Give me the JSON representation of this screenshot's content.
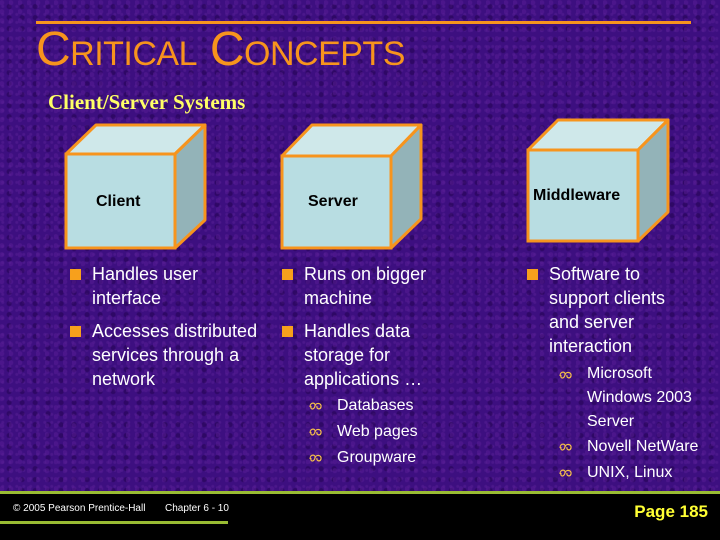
{
  "slide": {
    "title": "Critical Concepts",
    "subtitle": "Client/Server Systems"
  },
  "cubes": [
    {
      "label": "Client"
    },
    {
      "label": "Server"
    },
    {
      "label": "Middleware"
    }
  ],
  "columns": {
    "client": {
      "bullets": [
        {
          "text": "Handles user interface"
        },
        {
          "text": "Accesses distributed services through a network"
        }
      ]
    },
    "server": {
      "bullets": [
        {
          "text": "Runs on bigger machine"
        },
        {
          "text": "Handles data storage for applications …"
        }
      ],
      "sub_bullets": [
        "Databases",
        "Web pages",
        "Groupware"
      ]
    },
    "middleware": {
      "bullets": [
        {
          "text": "Software to support clients and server interaction"
        }
      ],
      "sub_bullets": [
        "Microsoft Windows 2003 Server",
        "Novell NetWare",
        "UNIX, Linux"
      ]
    }
  },
  "footer": {
    "copyright": "© 2005  Pearson Prentice-Hall",
    "chapter": "Chapter 6 - 10",
    "page": "Page 185"
  },
  "colors": {
    "background": "#3d0f80",
    "accent_orange": "#f7941d",
    "subtitle_yellow": "#ffff66",
    "cube_face": "#b8dde2",
    "footer_green": "#99bb33",
    "page_yellow": "#ffff33"
  }
}
